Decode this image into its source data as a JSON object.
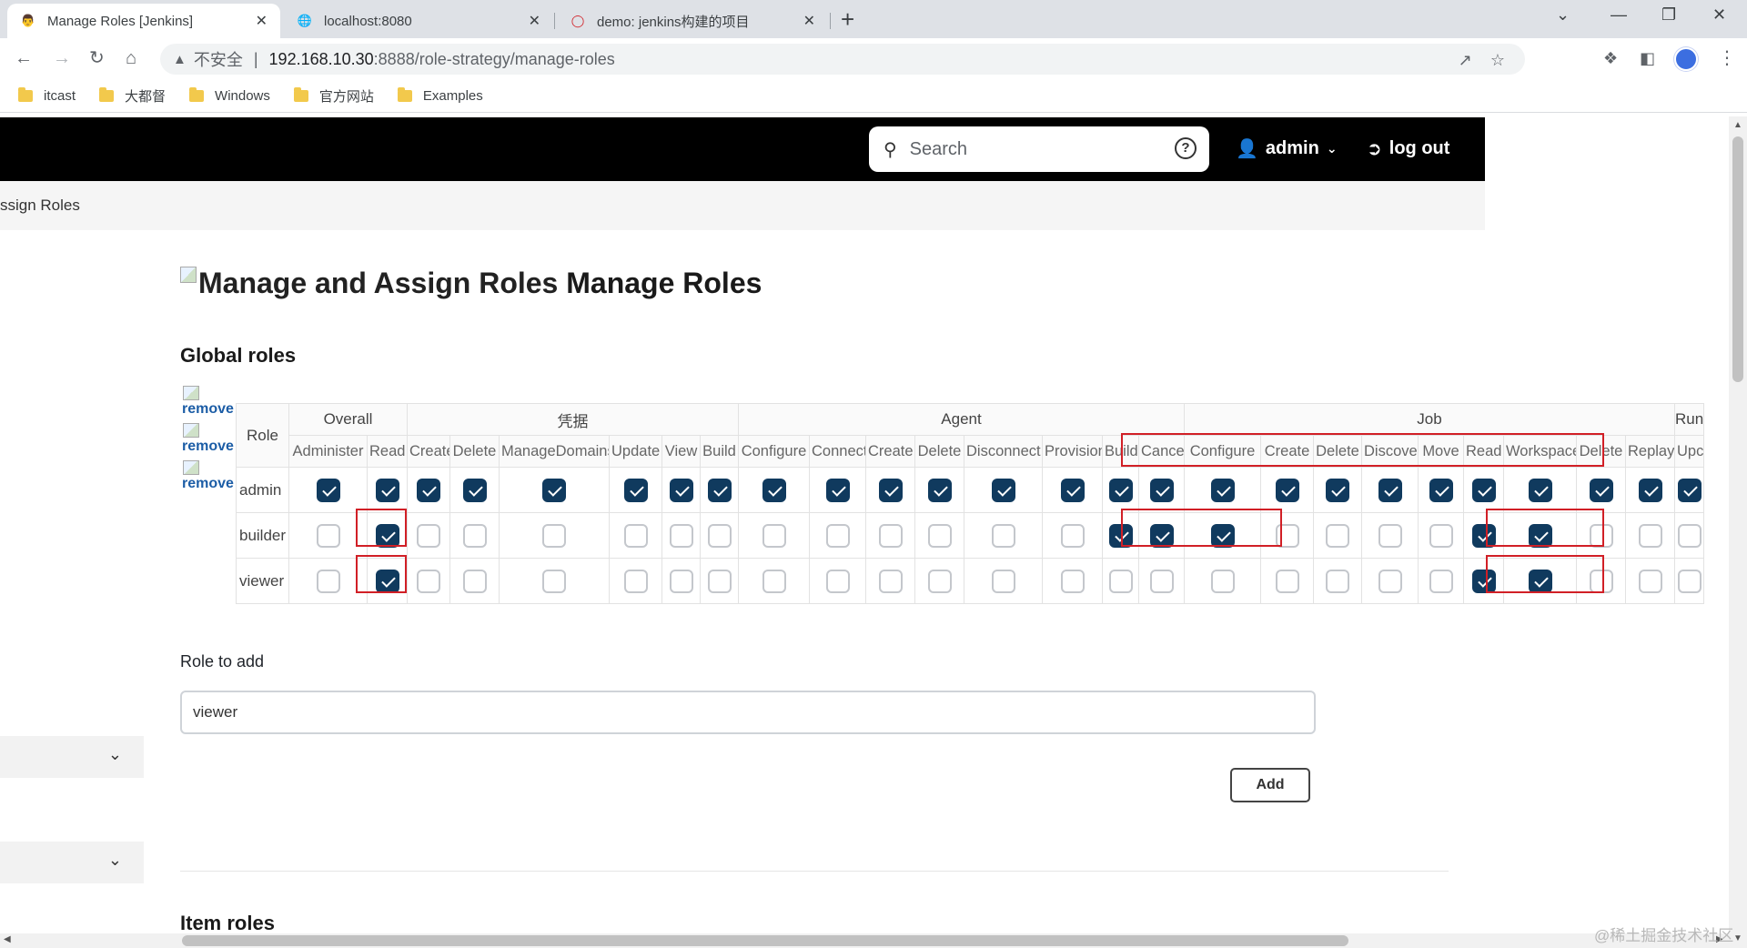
{
  "browser": {
    "tabs": [
      {
        "title": "Manage Roles [Jenkins]",
        "icon": "jenkins-icon",
        "active": true
      },
      {
        "title": "localhost:8080",
        "icon": "globe-icon",
        "active": false
      },
      {
        "title": "demo: jenkins构建的项目",
        "icon": "jenkins-red-icon",
        "active": false
      }
    ],
    "address": {
      "insecure_label": "不安全",
      "separator": "|",
      "host": "192.168.10.30",
      "rest": ":8888/role-strategy/manage-roles"
    },
    "bookmarks": [
      "itcast",
      "大都督",
      "Windows",
      "官方网站",
      "Examples"
    ]
  },
  "header": {
    "search_placeholder": "Search",
    "user": "admin",
    "logout": "log out"
  },
  "breadcrumb": "ssign Roles",
  "page": {
    "title_alt": "Manage and Assign Roles",
    "title": "Manage Roles",
    "global_roles_heading": "Global roles",
    "role_column": "Role",
    "groups": [
      {
        "name": "Overall",
        "span": 2
      },
      {
        "name": "凭据",
        "span": 6
      },
      {
        "name": "Agent",
        "span": 8
      },
      {
        "name": "Job",
        "span": 9
      },
      {
        "name": "Run",
        "span": 3
      }
    ],
    "permissions": [
      "Administer",
      "Read",
      "Create",
      "Delete",
      "ManageDomains",
      "Update",
      "View",
      "Build",
      "Configure",
      "Connect",
      "Create",
      "Delete",
      "Disconnect",
      "Provision",
      "Build",
      "Cancel",
      "Configure",
      "Create",
      "Delete",
      "Discover",
      "Move",
      "Read",
      "Workspace",
      "Delete",
      "Replay",
      "Upc"
    ],
    "remove_label": "remove",
    "roles": [
      {
        "name": "admin",
        "checks": [
          1,
          1,
          1,
          1,
          1,
          1,
          1,
          1,
          1,
          1,
          1,
          1,
          1,
          1,
          1,
          1,
          1,
          1,
          1,
          1,
          1,
          1,
          1,
          1,
          1,
          1
        ]
      },
      {
        "name": "builder",
        "checks": [
          0,
          1,
          0,
          0,
          0,
          0,
          0,
          0,
          0,
          0,
          0,
          0,
          0,
          0,
          1,
          1,
          1,
          0,
          0,
          0,
          0,
          1,
          1,
          0,
          0,
          0
        ]
      },
      {
        "name": "viewer",
        "checks": [
          0,
          1,
          0,
          0,
          0,
          0,
          0,
          0,
          0,
          0,
          0,
          0,
          0,
          0,
          0,
          0,
          0,
          0,
          0,
          0,
          0,
          1,
          1,
          0,
          0,
          0
        ]
      }
    ],
    "role_to_add_label": "Role to add",
    "role_to_add_value": "viewer",
    "add_button": "Add",
    "item_roles_heading": "Item roles"
  },
  "watermark": "@稀土掘金技术社区",
  "colors": {
    "checked": "#103a5e",
    "highlight": "#d11f26",
    "header": "#000000"
  }
}
